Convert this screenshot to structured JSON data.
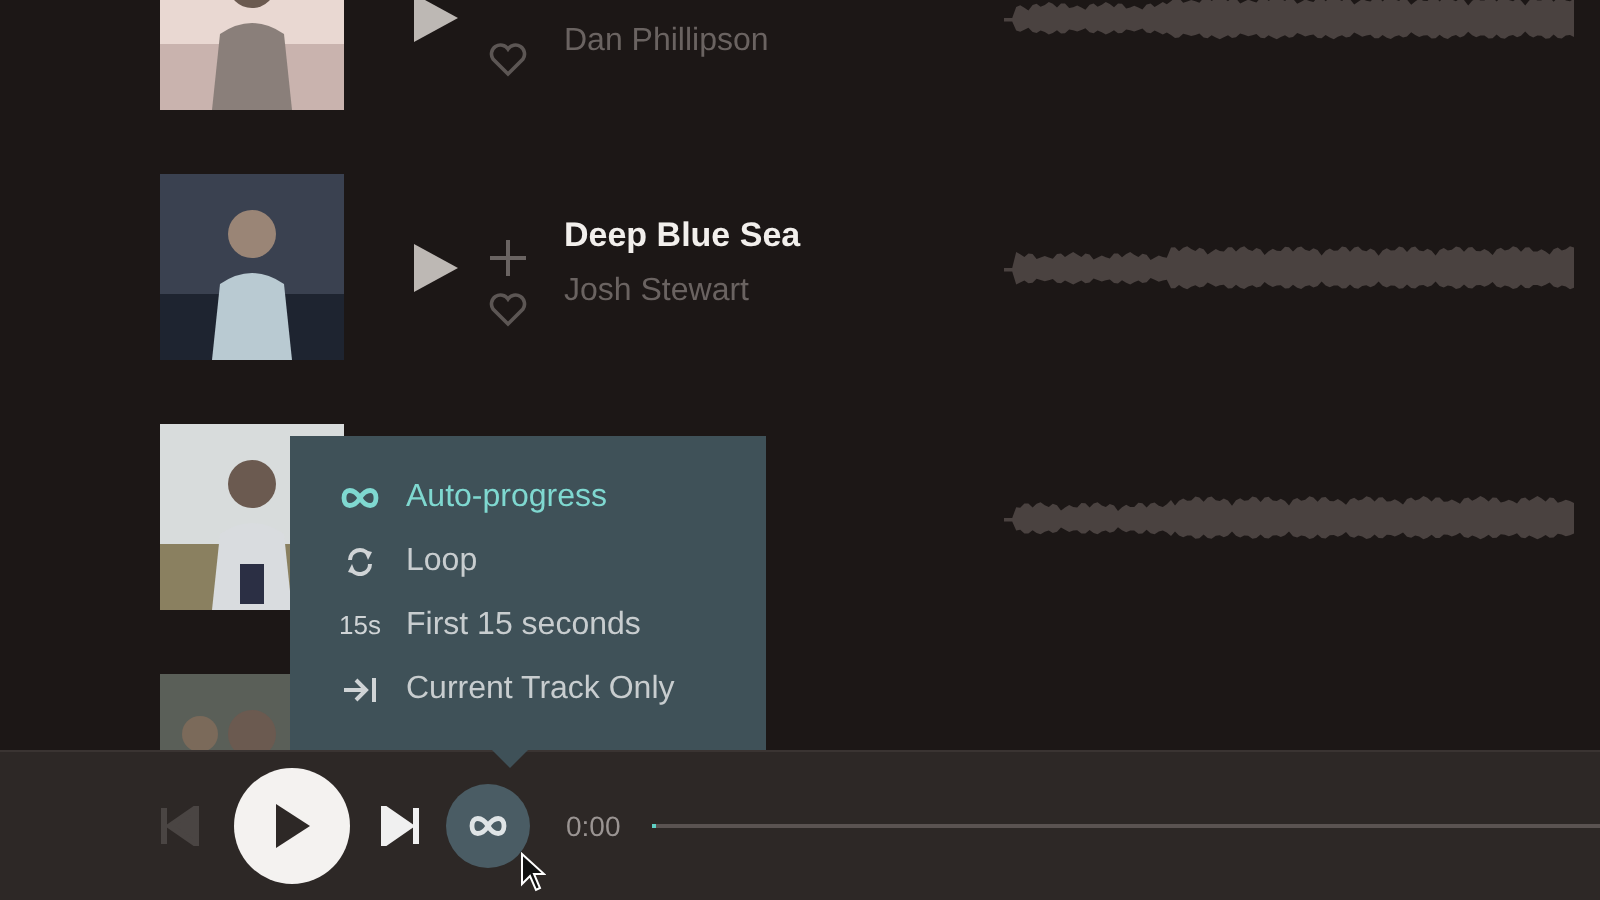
{
  "tracks": [
    {
      "kind": "picture",
      "artist": "Dan Phillipson",
      "hovered": false,
      "liked": false
    },
    {
      "kind": "picture",
      "title": "Deep Blue Sea",
      "artist": "Josh Stewart",
      "hovered": true,
      "liked": false
    },
    {
      "kind": "picture"
    },
    {
      "kind": "picture"
    }
  ],
  "play_mode_menu": {
    "items": [
      {
        "kind": "infinity",
        "label": "Auto-progress",
        "selected": true
      },
      {
        "kind": "loop",
        "label": "Loop",
        "selected": false
      },
      {
        "kind": "text",
        "icon_text": "15s",
        "label": "First 15 seconds",
        "selected": false
      },
      {
        "kind": "skip",
        "label": "Current Track Only",
        "selected": false
      }
    ]
  },
  "player": {
    "previous_disabled": true,
    "time": "0:00",
    "progress": {
      "level": 0
    }
  }
}
